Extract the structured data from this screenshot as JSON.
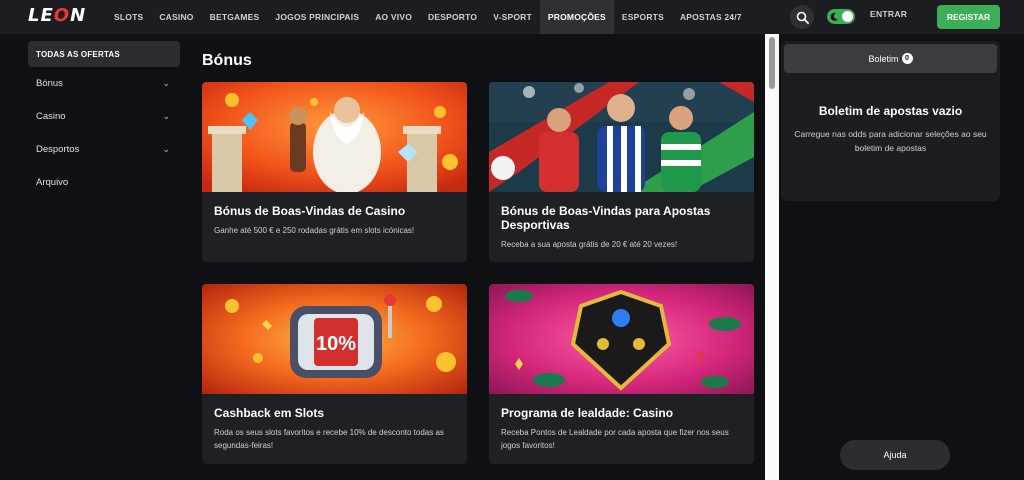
{
  "header": {
    "logo": {
      "pre": "LE",
      "mid": "O",
      "post": "N"
    },
    "nav": [
      "SLOTS",
      "CASINO",
      "BETGAMES",
      "JOGOS PRINCIPAIS",
      "AO VIVO",
      "DESPORTO",
      "V-SPORT",
      "PROMOÇÕES",
      "ESPORTS",
      "APOSTAS 24/7"
    ],
    "active_nav": "PROMOÇÕES",
    "login": "ENTRAR",
    "register": "REGISTAR",
    "theme_toggle_on": true
  },
  "sidebar": {
    "all_offers": "TODAS AS OFERTAS",
    "items": [
      {
        "label": "Bónus",
        "expandable": true
      },
      {
        "label": "Casino",
        "expandable": true
      },
      {
        "label": "Desportos",
        "expandable": true
      },
      {
        "label": "Arquivo",
        "expandable": false
      }
    ]
  },
  "main": {
    "title": "Bónus",
    "cards": [
      {
        "title": "Bónus de Boas-Vindas de Casino",
        "desc": "Ganhe até 500 € e 250 rodadas grátis em slots icónicas!"
      },
      {
        "title": "Bónus de Boas-Vindas para Apostas Desportivas",
        "desc": "Receba a sua aposta grátis de 20 € até 20 vezes!"
      },
      {
        "title": "Cashback em Slots",
        "desc": "Roda os seus slots favoritos e recebe 10% de desconto todas as segundas-feiras!"
      },
      {
        "title": "Programa de lealdade: Casino",
        "desc": "Receba Pontos de Lealdade por cada aposta que fizer nos seus jogos favoritos!"
      }
    ],
    "cashback_badge": "10%"
  },
  "betslip": {
    "tab": "Boletim",
    "count": "0",
    "empty_title": "Boletim de apostas vazio",
    "empty_hint": "Carregue nas odds para adicionar seleções ao seu boletim de apostas"
  },
  "help": "Ajuda",
  "colors": {
    "accent_green": "#3cae55",
    "bg": "#0f1013",
    "card": "#1f2024",
    "header": "#1c1d21"
  }
}
